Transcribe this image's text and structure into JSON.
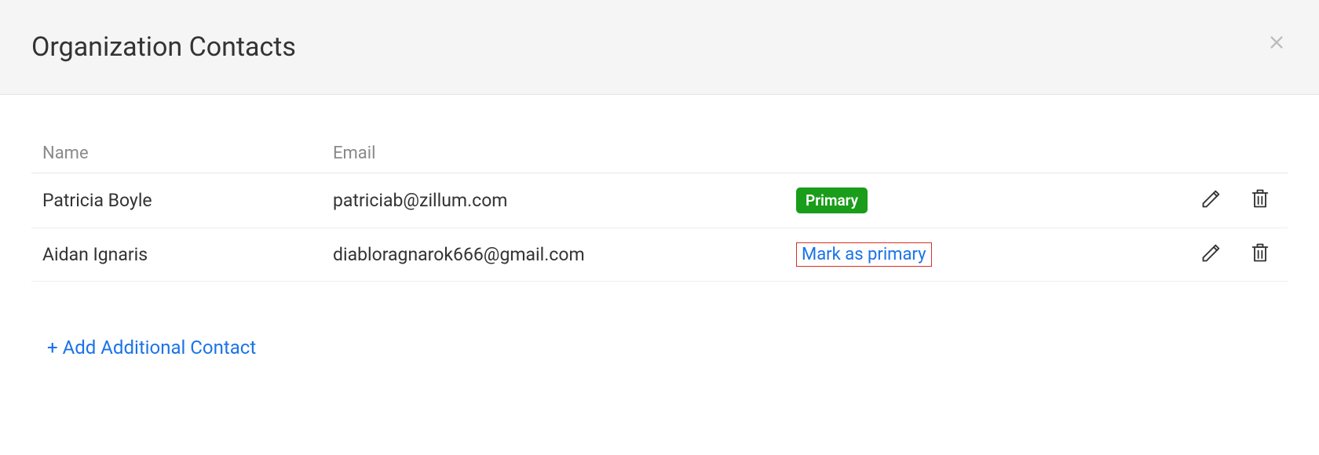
{
  "header": {
    "title": "Organization Contacts"
  },
  "table": {
    "columns": {
      "name": "Name",
      "email": "Email"
    },
    "rows": [
      {
        "name": "Patricia Boyle",
        "email": "patriciab@zillum.com",
        "status_type": "badge",
        "status_text": "Primary"
      },
      {
        "name": "Aidan Ignaris",
        "email": "diabloragnarok666@gmail.com",
        "status_type": "link",
        "status_text": "Mark as primary"
      }
    ]
  },
  "actions": {
    "add_contact": "+ Add Additional Contact"
  }
}
